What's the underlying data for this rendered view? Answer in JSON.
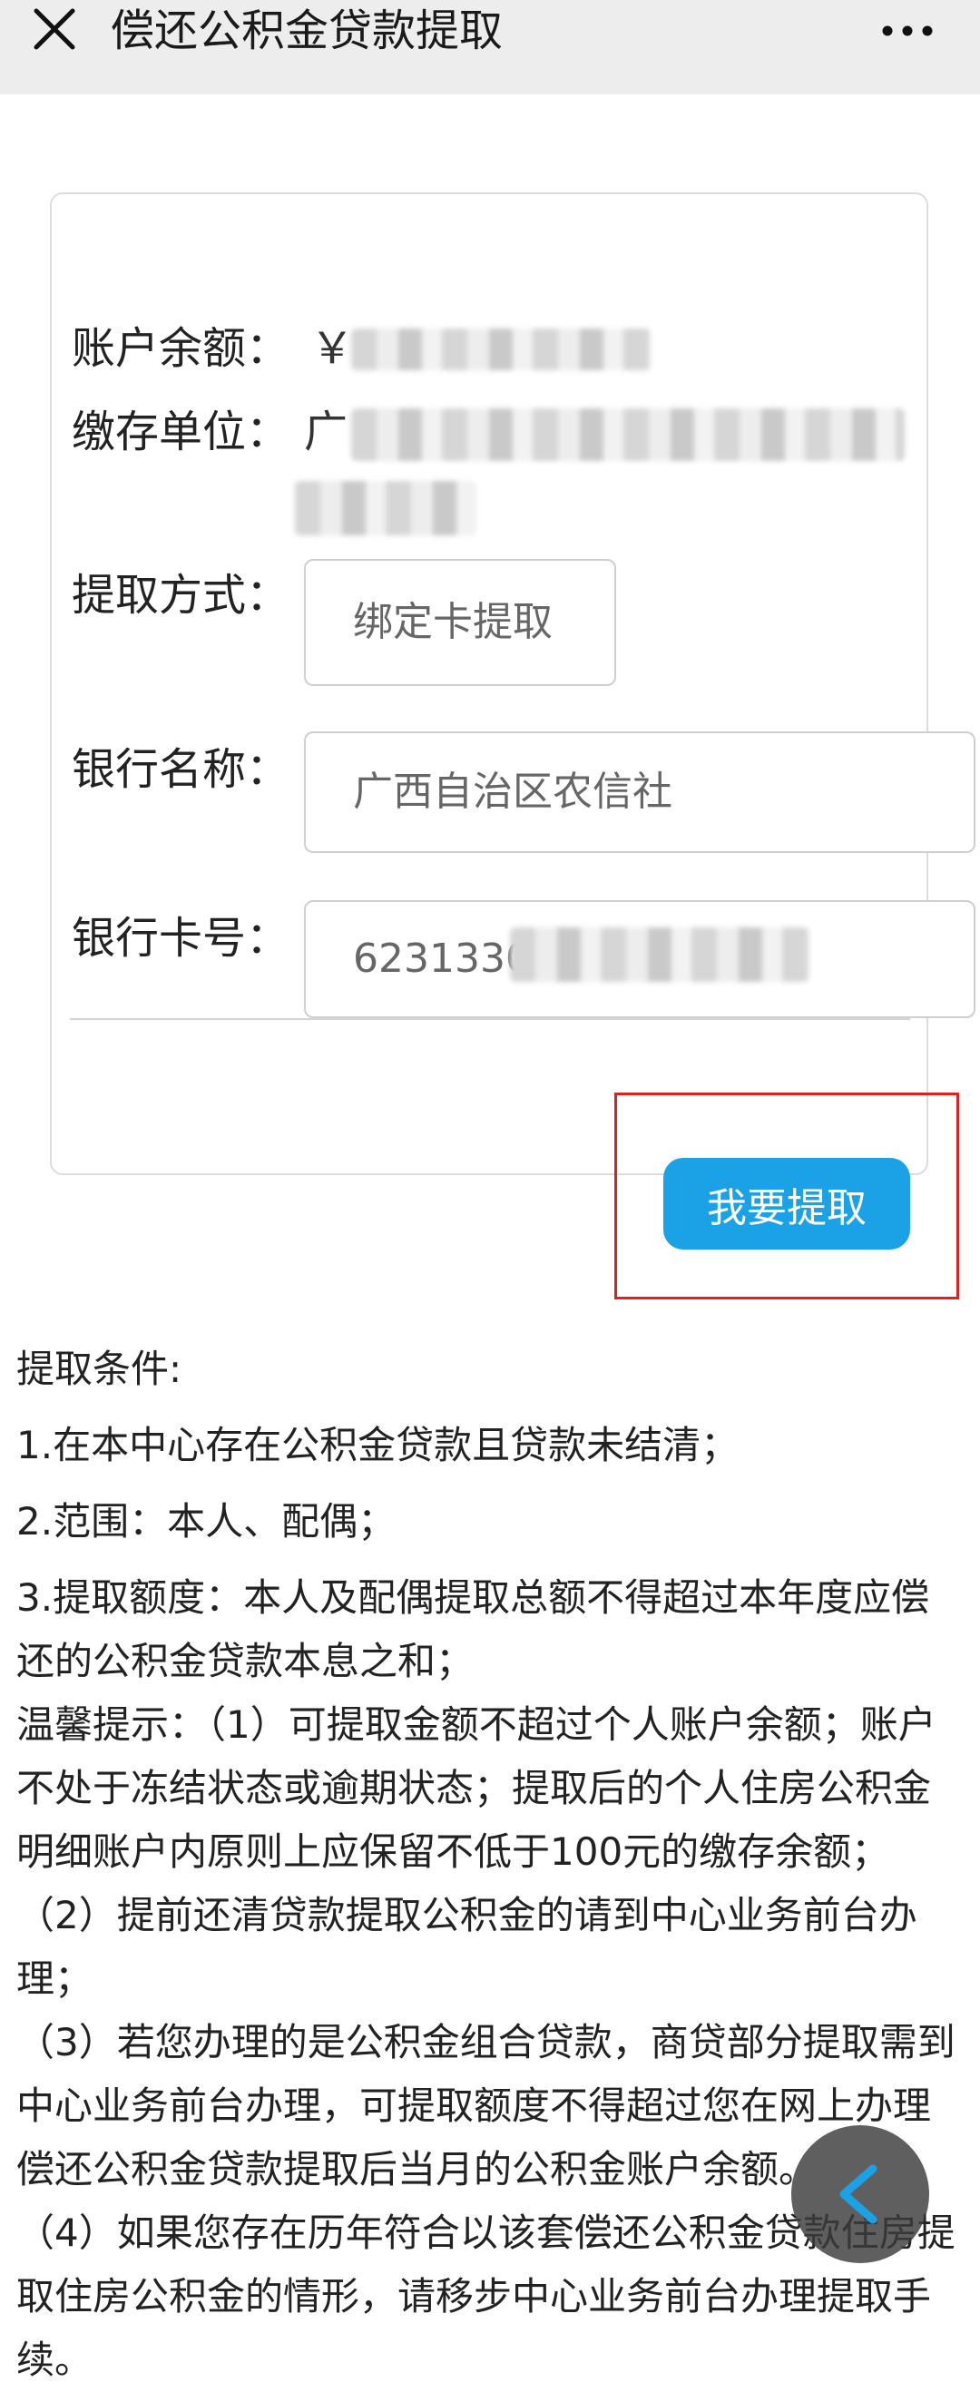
{
  "navbar": {
    "title": "偿还公积金贷款提取",
    "close_icon": "close-icon",
    "more_icon": "more-horizontal-icon"
  },
  "card": {
    "balance_label": "账户余额：",
    "balance_prefix": "￥",
    "unit_label": "缴存单位：",
    "unit_prefix": "广",
    "method_label": "提取方式：",
    "method_value": "绑定卡提取",
    "bank_label": "银行名称：",
    "bank_value": "广西自治区农信社",
    "card_label": "银行卡号：",
    "card_value": "6231330",
    "submit_label": "我要提取"
  },
  "conditions": {
    "title": "提取条件:",
    "items": [
      "1.在本中心存在公积金贷款且贷款未结清；",
      "2.范围：本人、配偶；",
      "3.提取额度：本人及配偶提取总额不得超过本年度应偿还的公积金贷款本息之和；",
      "温馨提示：（1）可提取金额不超过个人账户余额；账户不处于冻结状态或逾期状态；提取后的个人住房公积金明细账户内原则上应保留不低于100元的缴存余额；",
      "（2）提前还清贷款提取公积金的请到中心业务前台办理；",
      "（3）若您办理的是公积金组合贷款，商贷部分提取需到中心业务前台办理，可提取额度不得超过您在网上办理偿还公积金贷款提取后当月的公积金账户余额。",
      "（4）如果您存在历年符合以该套偿还公积金贷款住房提取住房公积金的情形，请移步中心业务前台办理提取手续。"
    ]
  },
  "colors": {
    "accent": "#1aa1e6",
    "highlight": "#e02020",
    "navbar_bg": "#ededed"
  },
  "back_fab_icon": "chevron-left-icon"
}
